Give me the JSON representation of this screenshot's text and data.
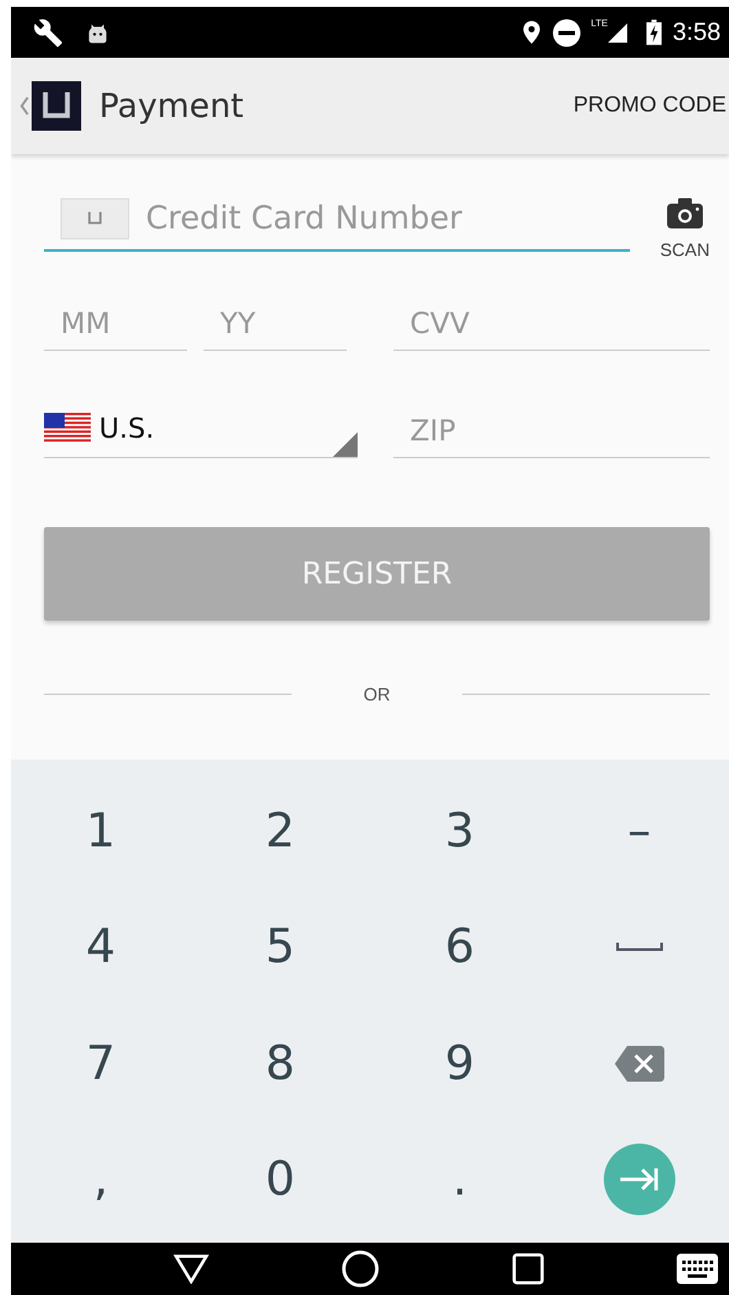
{
  "status_bar": {
    "lte": "LTE",
    "time": "3:58"
  },
  "app_bar": {
    "title": "Payment",
    "action": "PROMO CODE"
  },
  "form": {
    "card_number": {
      "placeholder": "Credit Card Number"
    },
    "scan": "SCAN",
    "month": {
      "placeholder": "MM"
    },
    "year": {
      "placeholder": "YY"
    },
    "cvv": {
      "placeholder": "CVV"
    },
    "country": {
      "value": "U.S."
    },
    "zip": {
      "placeholder": "ZIP"
    },
    "register": {
      "label": "REGISTER",
      "disabled": true
    },
    "divider": "OR"
  },
  "keyboard": {
    "keys": [
      {
        "kind": "char",
        "label": "1"
      },
      {
        "kind": "char",
        "label": "2"
      },
      {
        "kind": "char",
        "label": "3"
      },
      {
        "kind": "char",
        "label": "–"
      },
      {
        "kind": "char",
        "label": "4"
      },
      {
        "kind": "char",
        "label": "5"
      },
      {
        "kind": "char",
        "label": "6"
      },
      {
        "kind": "space"
      },
      {
        "kind": "char",
        "label": "7"
      },
      {
        "kind": "char",
        "label": "8"
      },
      {
        "kind": "char",
        "label": "9"
      },
      {
        "kind": "backspace"
      },
      {
        "kind": "char",
        "label": ","
      },
      {
        "kind": "char",
        "label": "0"
      },
      {
        "kind": "char",
        "label": "."
      },
      {
        "kind": "next"
      }
    ]
  }
}
